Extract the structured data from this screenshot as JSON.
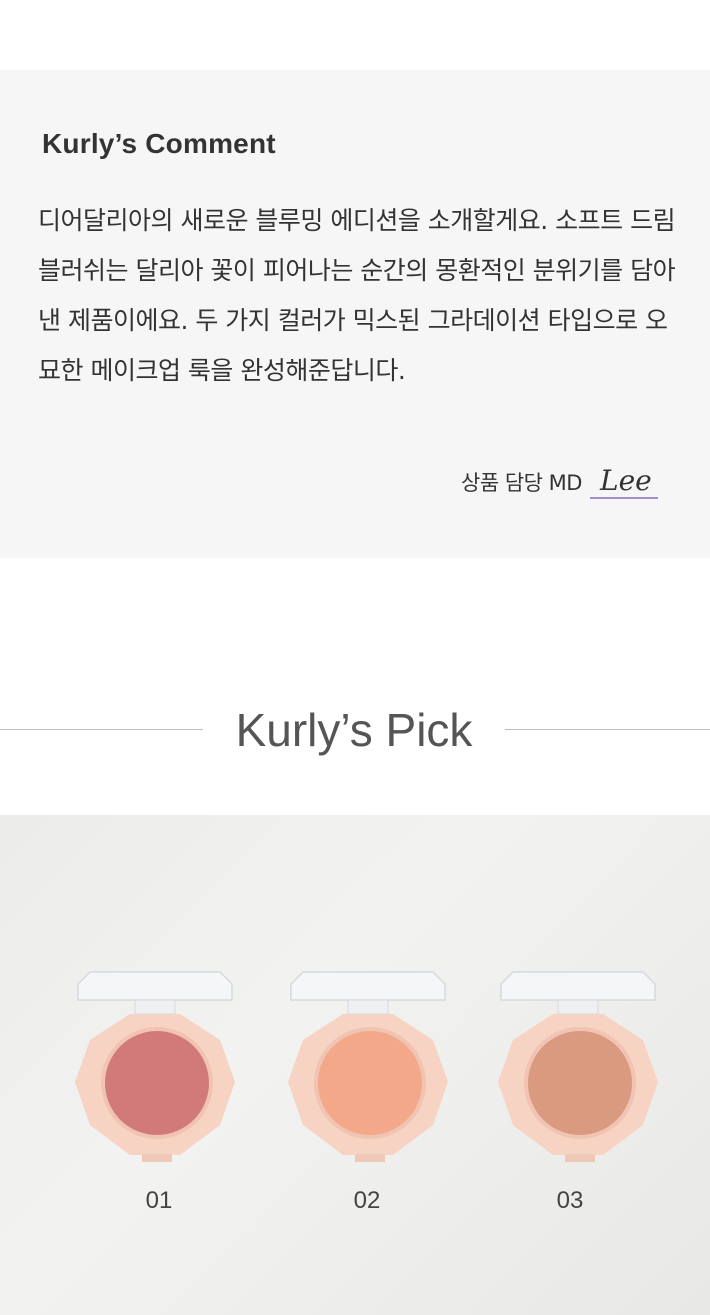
{
  "comment": {
    "title": "Kurly’s Comment",
    "body": "디어달리아의 새로운 블루밍 에디션을 소개할게요. 소프트 드림 블러쉬는 달리아 꽃이 피어나는 순간의 몽환적인 분위기를 담아낸 제품이에요. 두 가지 컬러가 믹스된 그라데이션 타입으로 오묘한 메이크업 룩을 완성해준답니다.",
    "md_label": "상품 담당 MD",
    "signature": "Lee"
  },
  "pick": {
    "title": "Kurly’s Pick"
  },
  "products": [
    {
      "number": "01",
      "pan_color": "#d27a7a",
      "pan_color_dark": "#c96a6e"
    },
    {
      "number": "02",
      "pan_color": "#f3a88a",
      "pan_color_dark": "#ee9682"
    },
    {
      "number": "03",
      "pan_color": "#d99a80",
      "pan_color_dark": "#c98670"
    }
  ],
  "colors": {
    "comment_bg": "#f6f6f6",
    "signature_underline": "#8a6bbd",
    "case_color": "#f6d3c2"
  }
}
